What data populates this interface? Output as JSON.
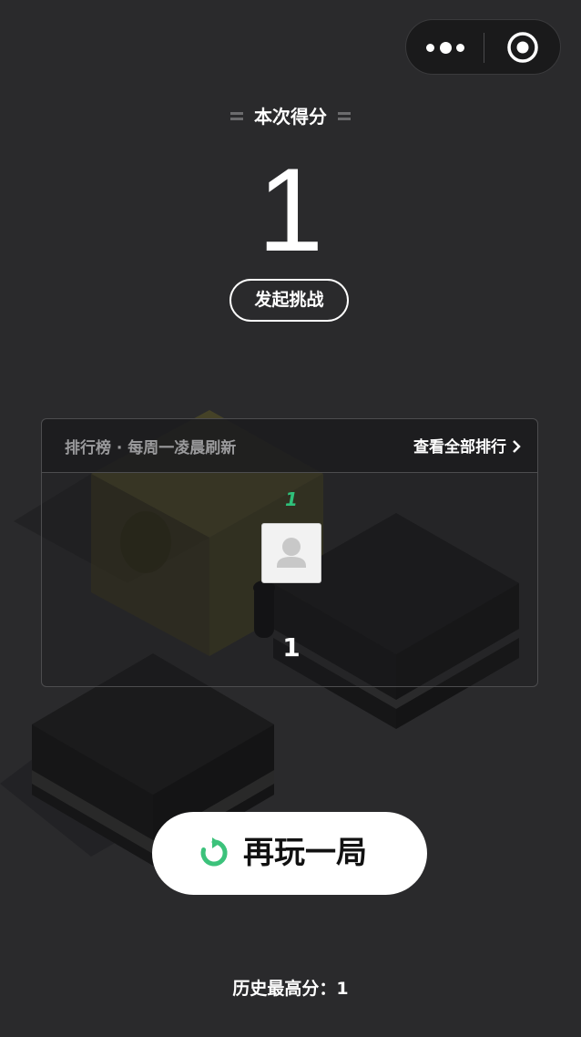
{
  "score_section": {
    "title": "本次得分",
    "score": "1",
    "challenge_label": "发起挑战"
  },
  "leaderboard": {
    "refresh_note": "排行榜 · 每周一凌晨刷新",
    "view_all_label": "查看全部排行",
    "entries": [
      {
        "rank": "1",
        "score": "1"
      }
    ]
  },
  "replay_label": "再玩一局",
  "history_best": "历史最高分：1",
  "icons": {
    "capsule_more": "more-dots-icon",
    "capsule_close": "target-close-icon",
    "view_all_arrow": "chevron-right-icon",
    "replay": "replay-arrow-icon",
    "avatar": "default-avatar-icon"
  },
  "colors": {
    "background": "#2a2a2c",
    "accent_green": "#2fc07a",
    "button_white": "#ffffff"
  }
}
